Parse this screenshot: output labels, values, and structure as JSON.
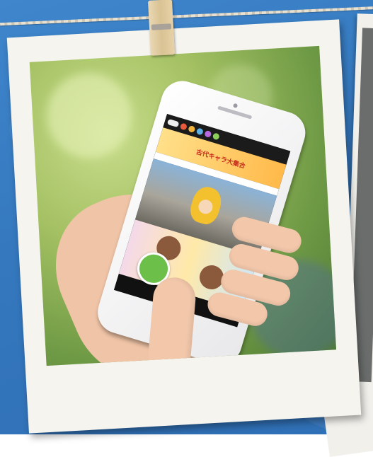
{
  "scene": {
    "background_color": "#3578be",
    "frame_color": "#f5f4ef"
  },
  "icons": [
    "clothespin",
    "smartphone",
    "hand"
  ],
  "phone_screen": {
    "banner_title": "古代キャラ大集合",
    "caption": "",
    "badge_color": "#6cc04a",
    "accent_color": "#c62d1d"
  }
}
